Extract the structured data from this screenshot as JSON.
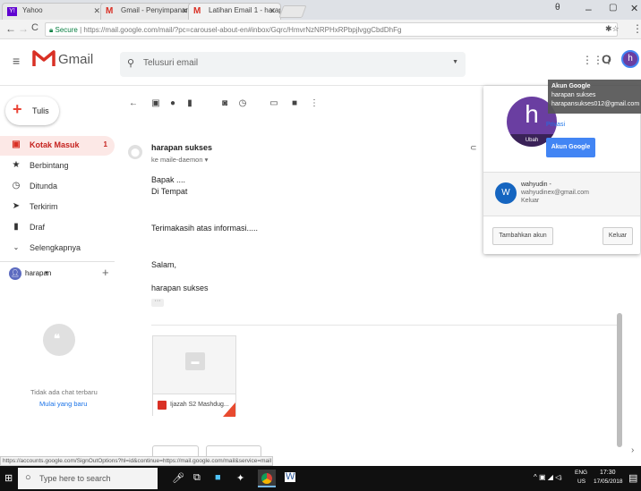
{
  "browser": {
    "tabs": [
      {
        "label": "Yahoo"
      },
      {
        "label": "Gmail - Penyimpanan da"
      },
      {
        "label": "Latihan Email 1 - harapa"
      }
    ],
    "url_secure": "Secure",
    "url": "https://mail.google.com/mail/?pc=carousel-about-en#inbox/Gqrc/HmvrNzNRPHxRPbpjlvggCbdDhFg",
    "status_url": "https://accounts.google.com/SignOutOptions?hl=id&continue=https://mail.google.com/mail&service=mail"
  },
  "gmail": {
    "logo_text": "Gmail",
    "search_placeholder": "Telusuri email",
    "avatar_letter": "h"
  },
  "sidebar": {
    "compose_label": "Tulis",
    "items": [
      {
        "label": "Kotak Masuk",
        "count": "1",
        "icon": "inbox-icon"
      },
      {
        "label": "Berbintang",
        "icon": "star-icon"
      },
      {
        "label": "Ditunda",
        "icon": "clock-icon"
      },
      {
        "label": "Terkirim",
        "icon": "send-icon"
      },
      {
        "label": "Draf",
        "icon": "draft-icon"
      },
      {
        "label": "Selengkapnya",
        "icon": "chevron-down-icon"
      }
    ],
    "hangouts_user": "harapan",
    "no_chats": "Tidak ada chat terbaru",
    "start_new": "Mulai yang baru"
  },
  "message": {
    "sender": "harapan sukses",
    "to": "ke maile-daemon",
    "lines": [
      "Bapak ....",
      "Di Tempat",
      "Terimakasih atas informasi.....",
      "Salam,",
      "harapan sukses"
    ],
    "attachment_name": "Ijazah S2 Mashdug..."
  },
  "account": {
    "tooltip_title": "Akun Google",
    "tooltip_name": "harapan sukses",
    "tooltip_email": "harapansukses012@gmail.com",
    "big_avatar_letter": "h",
    "change_label": "Ubah",
    "privacy": "Privasi",
    "google_account_button": "Akun Google",
    "other_name": "wahyudin -",
    "other_email": "wahyudinex@gmail.com",
    "other_status": "Keluar",
    "other_letter": "W",
    "add_account": "Tambahkan akun",
    "sign_out": "Keluar"
  },
  "taskbar": {
    "search_placeholder": "Type here to search",
    "lang": "ENG",
    "lang_sub": "US",
    "time": "17:30",
    "date": "17/05/2018"
  },
  "colors": {
    "accent_red": "#d93025",
    "avatar_purple": "#6a3ea1",
    "button_blue": "#4285f4"
  }
}
